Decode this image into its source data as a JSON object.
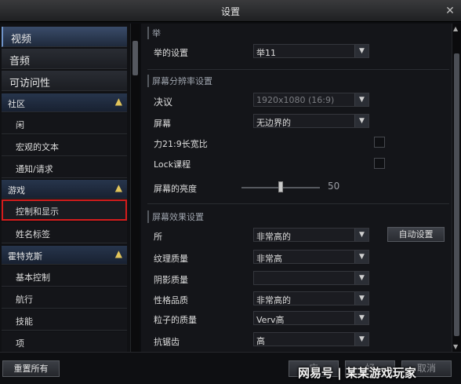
{
  "window": {
    "title": "设置",
    "close_icon": "close-icon"
  },
  "sidebar": {
    "top_items": [
      {
        "label": "视频",
        "active": true
      },
      {
        "label": "音频"
      },
      {
        "label": "可访问性"
      }
    ],
    "groups": [
      {
        "label": "社区",
        "items": [
          "闲",
          "宏观的文本",
          "通知/请求"
        ]
      },
      {
        "label": "游戏",
        "items": [
          "控制和显示",
          "姓名标签"
        ]
      },
      {
        "label": "霍特克斯",
        "items": [
          "基本控制",
          "航行",
          "技能",
          "项"
        ]
      }
    ],
    "selected_item": "控制和显示"
  },
  "content": {
    "section1": {
      "header": "举",
      "label": "举的设置",
      "value": "举11"
    },
    "section2": {
      "header": "屏幕分辨率设置",
      "resolution": {
        "label": "决议",
        "value": "1920x1080 (16:9)"
      },
      "screen": {
        "label": "屏幕",
        "value": "无边界的"
      },
      "aspect": {
        "label": "力21:9长宽比"
      },
      "lock": {
        "label": "Lock课程"
      },
      "brightness": {
        "label": "屏幕的亮度",
        "value": "50",
        "percent": 50
      }
    },
    "section3": {
      "header": "屏幕效果设置",
      "auto_button": "自动设置",
      "rows": [
        {
          "label": "所",
          "value": "非常高的"
        },
        {
          "label": "纹理质量",
          "value": "非常高"
        },
        {
          "label": "阴影质量",
          "value": ""
        },
        {
          "label": "性格品质",
          "value": "非常高的"
        },
        {
          "label": "粒子的质量",
          "value": "Verv高"
        },
        {
          "label": "抗锯齿",
          "value": "高"
        }
      ]
    }
  },
  "footer": {
    "reset_label": "重置所有",
    "apply_label": "应",
    "ok_label": "好",
    "cancel_label": "取消",
    "watermark": "网易号 | 某某游戏玩家"
  },
  "colors": {
    "selection_border": "#d41c1c",
    "group_header": "#27354c",
    "chevron": "#e1c45a"
  }
}
